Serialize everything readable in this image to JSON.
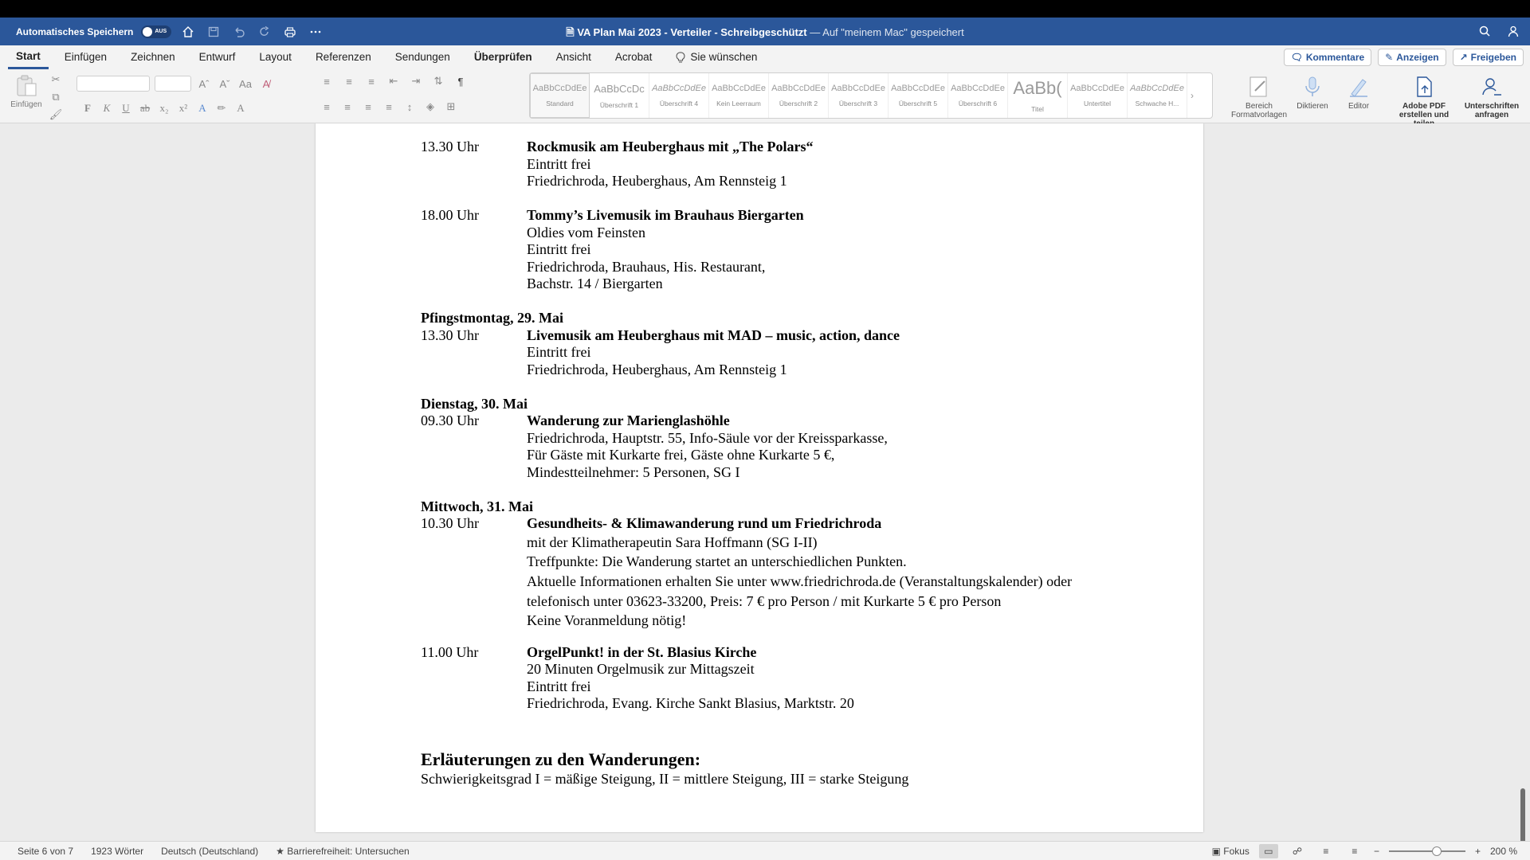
{
  "titlebar": {
    "autosave_label": "Automatisches Speichern",
    "autosave_state": "AUS",
    "doc_title": "VA Plan Mai 2023 - Verteiler",
    "protection": "Schreibgeschützt",
    "save_location": "— Auf \"meinem Mac\" gespeichert"
  },
  "tabs": [
    "Start",
    "Einfügen",
    "Zeichnen",
    "Entwurf",
    "Layout",
    "Referenzen",
    "Sendungen",
    "Überprüfen",
    "Ansicht",
    "Acrobat"
  ],
  "tell_me": "Sie wünschen",
  "ribbon_right": {
    "comments": "Kommentare",
    "show": "Anzeigen",
    "share": "Freigeben"
  },
  "ribbon": {
    "paste_label": "Einfügen",
    "styles": [
      {
        "preview": "AaBbCcDdEe",
        "name": "Standard"
      },
      {
        "preview": "AaBbCcDc",
        "name": "Überschrift 1"
      },
      {
        "preview": "AaBbCcDdEe",
        "name": "Überschrift 4"
      },
      {
        "preview": "AaBbCcDdEe",
        "name": "Kein Leerraum"
      },
      {
        "preview": "AaBbCcDdEe",
        "name": "Überschrift 2"
      },
      {
        "preview": "AaBbCcDdEe",
        "name": "Überschrift 3"
      },
      {
        "preview": "AaBbCcDdEe",
        "name": "Überschrift 5"
      },
      {
        "preview": "AaBbCcDdEe",
        "name": "Überschrift 6"
      },
      {
        "preview": "AaBb(",
        "name": "Titel"
      },
      {
        "preview": "AaBbCcDdEe",
        "name": "Untertitel"
      },
      {
        "preview": "AaBbCcDdEe",
        "name": "Schwache H..."
      }
    ],
    "styles_pane": "Bereich Formatvorlagen",
    "dictate": "Diktieren",
    "editor": "Editor",
    "adobe_pdf": "Adobe PDF erstellen und teilen",
    "signatures": "Unterschriften anfragen"
  },
  "document": {
    "e1_time": "13.30 Uhr",
    "e1_title": "Rockmusik am Heuberghaus mit „The Polars“",
    "e1_l1": "Eintritt frei",
    "e1_l2": "Friedrichroda, Heuberghaus, Am Rennsteig 1",
    "e2_time": "18.00 Uhr",
    "e2_title": "Tommy’s Livemusik im Brauhaus Biergarten",
    "e2_l1": "Oldies vom Feinsten",
    "e2_l2": "Eintritt frei",
    "e2_l3": "Friedrichroda, Brauhaus, His. Restaurant,",
    "e2_l4": "Bachstr. 14 / Biergarten",
    "d1": "Pfingstmontag, 29. Mai",
    "e3_time": "13.30 Uhr",
    "e3_title": "Livemusik am Heuberghaus mit MAD – music, action, dance",
    "e3_l1": "Eintritt frei",
    "e3_l2": "Friedrichroda, Heuberghaus, Am Rennsteig 1",
    "d2": "Dienstag, 30. Mai",
    "e4_time": "09.30 Uhr",
    "e4_title": "Wanderung zur Marienglashöhle",
    "e4_l1": "Friedrichroda, Hauptstr. 55, Info-Säule vor der Kreissparkasse,",
    "e4_l2": "Für Gäste mit Kurkarte frei, Gäste ohne Kurkarte 5 €,",
    "e4_l3": "Mindestteilnehmer: 5 Personen, SG I",
    "d3": "Mittwoch, 31. Mai",
    "e5_time": "10.30 Uhr",
    "e5_title": "Gesundheits- & Klimawanderung rund um Friedrichroda",
    "e5_l1": "mit der Klimatherapeutin Sara Hoffmann (SG I-II)",
    "e5_l2": "Treffpunkte: Die Wanderung startet an unterschiedlichen Punkten.",
    "e5_l3": "Aktuelle Informationen erhalten Sie unter www.friedrichroda.de (Veranstaltungskalender) oder",
    "e5_l4": "telefonisch unter 03623-33200, Preis: 7 € pro Person / mit Kurkarte 5 € pro Person",
    "e5_l5": "Keine Voranmeldung nötig!",
    "e6_time": "11.00 Uhr",
    "e6_title": "OrgelPunkt! in der St. Blasius Kirche",
    "e6_l1": "20 Minuten Orgelmusik zur Mittagszeit",
    "e6_l2": "Eintritt frei",
    "e6_l3": "Friedrichroda, Evang. Kirche Sankt Blasius, Marktstr. 20",
    "heading": "Erläuterungen zu den Wanderungen:",
    "legend": "Schwierigkeitsgrad I = mäßige Steigung, II = mittlere Steigung, III = starke Steigung"
  },
  "status": {
    "page": "Seite 6 von 7",
    "words": "1923 Wörter",
    "language": "Deutsch (Deutschland)",
    "accessibility": "Barrierefreiheit: Untersuchen",
    "focus": "Fokus",
    "zoom": "200 %"
  },
  "colors": {
    "accent": "#2b579a",
    "titlebar": "#2b579a",
    "ribbon_bg": "#f3f3f3",
    "workspace": "#ebebeb"
  }
}
